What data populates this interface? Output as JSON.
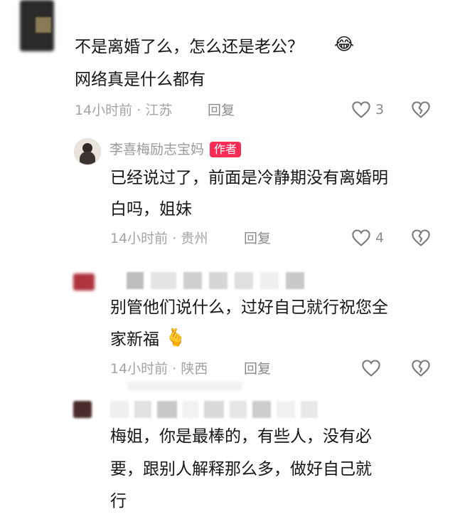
{
  "comments": [
    {
      "text_lines": [
        "不是离婚了么，怎么还是老公？",
        "网络真是什么都有"
      ],
      "time": "14小时前",
      "location": "江苏",
      "reply_label": "回复",
      "likes": "3"
    },
    {
      "author": "李喜梅励志宝妈",
      "author_badge": "作者",
      "text_lines": [
        "已经说过了，前面是冷静期没有离婚明",
        "白吗，姐妹"
      ],
      "time": "14小时前",
      "location": "贵州",
      "reply_label": "回复",
      "likes": "4"
    },
    {
      "text_lines": [
        "别管他们说什么，过好自己就行祝您全",
        "家新福"
      ],
      "time": "14小时前",
      "location": "陕西",
      "reply_label": "回复"
    },
    {
      "text_lines": [
        "梅姐，你是最棒的，有些人，没有必",
        "要，跟别人解释那么多，做好自己就",
        "行"
      ]
    }
  ],
  "separator": "·",
  "icons": {
    "like": "heart-outline-icon",
    "dislike": "broken-heart-icon",
    "emoji_laugh": "laughing-emoji-icon",
    "emoji_heart_hand": "finger-heart-emoji-icon"
  },
  "colors": {
    "badge": "#fe2c55",
    "meta": "#a3a3a3",
    "text": "#161616"
  }
}
